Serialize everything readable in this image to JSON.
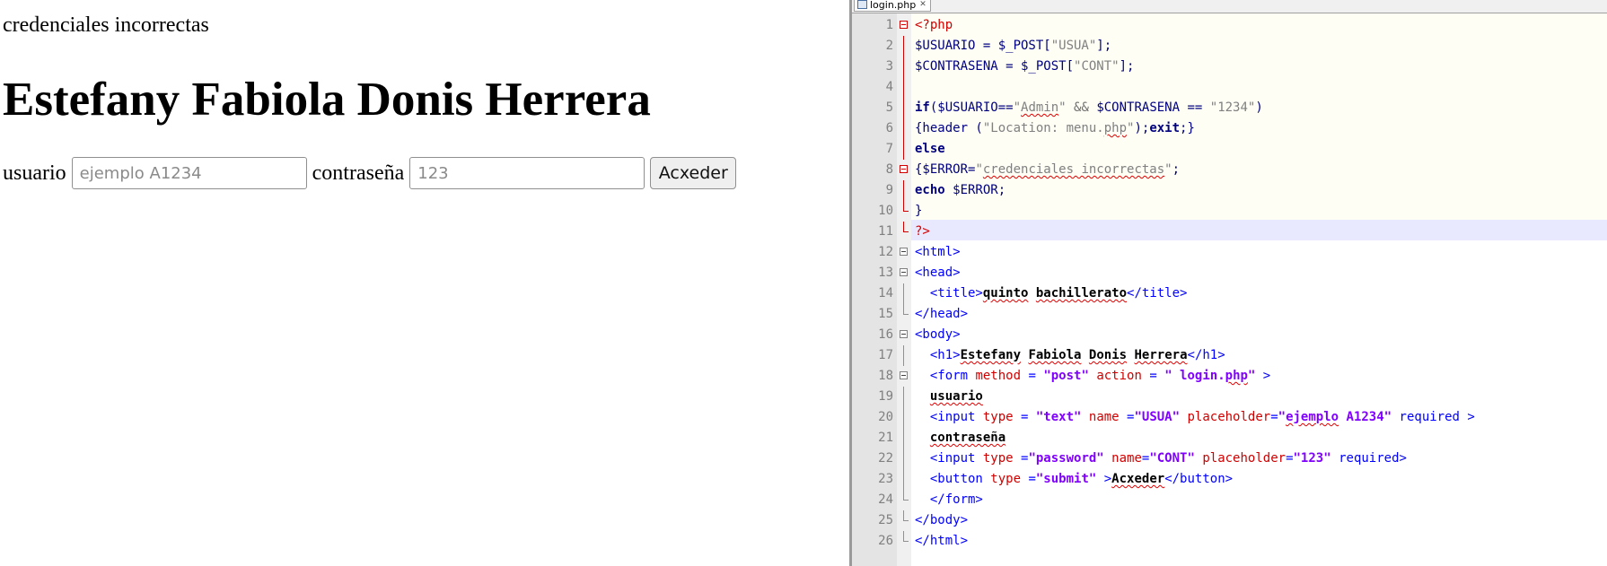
{
  "browser": {
    "error_message": "credenciales incorrectas",
    "heading": "Estefany Fabiola Donis Herrera",
    "usuario_label": "usuario",
    "usuario_placeholder": "ejemplo A1234",
    "password_label": "contraseña",
    "password_placeholder": "123",
    "submit_label": "Acxeder"
  },
  "editor": {
    "tab_label": "login.php",
    "tab_icon": "file-icon",
    "close_icon": "close-icon",
    "colors": {
      "php_tag": "#d00000",
      "variable": "#000080",
      "string": "#808080",
      "html_tag": "#0000ff",
      "attr_name": "#d00000",
      "attr_value": "#8000ff",
      "current_line": "#e8e8ff"
    },
    "lines": [
      [
        {
          "t": "<?php",
          "c": "php"
        }
      ],
      [
        {
          "t": "$USUARIO = $_POST[",
          "c": "var"
        },
        {
          "t": "\"USUA\"",
          "c": "str"
        },
        {
          "t": "];",
          "c": "var"
        }
      ],
      [
        {
          "t": "$CONTRASENA = $_POST[",
          "c": "var"
        },
        {
          "t": "\"CONT\"",
          "c": "str"
        },
        {
          "t": "];",
          "c": "var"
        }
      ],
      [],
      [
        {
          "t": "if",
          "c": "kw"
        },
        {
          "t": "($USUARIO==",
          "c": "var"
        },
        {
          "t": "\"",
          "c": "str"
        },
        {
          "t": "Admin",
          "c": "str",
          "s": true
        },
        {
          "t": "\"",
          "c": "str"
        },
        {
          "t": " && ",
          "c": "op"
        },
        {
          "t": "$CONTRASENA == ",
          "c": "var"
        },
        {
          "t": "\"1234\"",
          "c": "str"
        },
        {
          "t": ")",
          "c": "var"
        }
      ],
      [
        {
          "t": "{header (",
          "c": "var"
        },
        {
          "t": "\"Location: menu.",
          "c": "str"
        },
        {
          "t": "php",
          "c": "str",
          "s": true
        },
        {
          "t": "\"",
          "c": "str"
        },
        {
          "t": ");",
          "c": "var"
        },
        {
          "t": "exit",
          "c": "kw"
        },
        {
          "t": ";}",
          "c": "var"
        }
      ],
      [
        {
          "t": "else",
          "c": "kw"
        }
      ],
      [
        {
          "t": "{$ERROR=",
          "c": "var"
        },
        {
          "t": "\"",
          "c": "str"
        },
        {
          "t": "credenciales incorrectas",
          "c": "str",
          "s": true
        },
        {
          "t": "\"",
          "c": "str"
        },
        {
          "t": ";",
          "c": "var"
        }
      ],
      [
        {
          "t": "echo",
          "c": "kw"
        },
        {
          "t": " $ERROR;",
          "c": "var"
        }
      ],
      [
        {
          "t": "}",
          "c": "var"
        }
      ],
      [
        {
          "t": "?>",
          "c": "php"
        }
      ],
      [
        {
          "t": "<html>",
          "c": "tag"
        }
      ],
      [
        {
          "t": "<head>",
          "c": "tag"
        }
      ],
      [
        {
          "t": "  <title>",
          "c": "tag"
        },
        {
          "t": "quinto",
          "c": "bold",
          "s": true
        },
        {
          "t": " ",
          "c": "bold"
        },
        {
          "t": "bachillerato",
          "c": "bold",
          "s": true
        },
        {
          "t": "</title>",
          "c": "tag"
        }
      ],
      [
        {
          "t": "</head>",
          "c": "tag"
        }
      ],
      [
        {
          "t": "<body>",
          "c": "tag"
        }
      ],
      [
        {
          "t": "  <h1>",
          "c": "tag"
        },
        {
          "t": "Estefany",
          "c": "bold",
          "s": true
        },
        {
          "t": " ",
          "c": "bold"
        },
        {
          "t": "Fabiola",
          "c": "bold",
          "s": true
        },
        {
          "t": " ",
          "c": "bold"
        },
        {
          "t": "Donis",
          "c": "bold",
          "s": true
        },
        {
          "t": " ",
          "c": "bold"
        },
        {
          "t": "Herrera",
          "c": "bold",
          "s": true
        },
        {
          "t": "</h1>",
          "c": "tag"
        }
      ],
      [
        {
          "t": "  <form ",
          "c": "tag"
        },
        {
          "t": "method",
          "c": "attr"
        },
        {
          "t": " = ",
          "c": "tag"
        },
        {
          "t": "\"post\"",
          "c": "aval"
        },
        {
          "t": " ",
          "c": "tag"
        },
        {
          "t": "action",
          "c": "attr"
        },
        {
          "t": " = ",
          "c": "tag"
        },
        {
          "t": "\" login.",
          "c": "aval"
        },
        {
          "t": "php",
          "c": "aval",
          "s": true
        },
        {
          "t": "\"",
          "c": "aval"
        },
        {
          "t": " >",
          "c": "tag"
        }
      ],
      [
        {
          "t": "  ",
          "c": "plain"
        },
        {
          "t": "usuario",
          "c": "bold",
          "s": true
        }
      ],
      [
        {
          "t": "  <input ",
          "c": "tag"
        },
        {
          "t": "type",
          "c": "attr"
        },
        {
          "t": " = ",
          "c": "tag"
        },
        {
          "t": "\"text\"",
          "c": "aval"
        },
        {
          "t": " ",
          "c": "tag"
        },
        {
          "t": "name",
          "c": "attr"
        },
        {
          "t": " =",
          "c": "tag"
        },
        {
          "t": "\"USUA\"",
          "c": "aval"
        },
        {
          "t": " ",
          "c": "tag"
        },
        {
          "t": "placeholder",
          "c": "attr"
        },
        {
          "t": "=",
          "c": "tag"
        },
        {
          "t": "\"",
          "c": "aval"
        },
        {
          "t": "ejemplo",
          "c": "aval",
          "s": true
        },
        {
          "t": " A1234\"",
          "c": "aval"
        },
        {
          "t": " required >",
          "c": "tag"
        }
      ],
      [
        {
          "t": "  ",
          "c": "plain"
        },
        {
          "t": "contraseña",
          "c": "bold",
          "s": true
        }
      ],
      [
        {
          "t": "  <input ",
          "c": "tag"
        },
        {
          "t": "type",
          "c": "attr"
        },
        {
          "t": " =",
          "c": "tag"
        },
        {
          "t": "\"password\"",
          "c": "aval"
        },
        {
          "t": " ",
          "c": "tag"
        },
        {
          "t": "name",
          "c": "attr"
        },
        {
          "t": "=",
          "c": "tag"
        },
        {
          "t": "\"CONT\"",
          "c": "aval"
        },
        {
          "t": " ",
          "c": "tag"
        },
        {
          "t": "placeholder",
          "c": "attr"
        },
        {
          "t": "=",
          "c": "tag"
        },
        {
          "t": "\"123\"",
          "c": "aval"
        },
        {
          "t": " required>",
          "c": "tag"
        }
      ],
      [
        {
          "t": "  <button ",
          "c": "tag"
        },
        {
          "t": "type",
          "c": "attr"
        },
        {
          "t": " =",
          "c": "tag"
        },
        {
          "t": "\"submit\"",
          "c": "aval"
        },
        {
          "t": " >",
          "c": "tag"
        },
        {
          "t": "Acxeder",
          "c": "bold",
          "s": true
        },
        {
          "t": "</button>",
          "c": "tag"
        }
      ],
      [
        {
          "t": "  </form>",
          "c": "tag"
        }
      ],
      [
        {
          "t": "</body>",
          "c": "tag"
        }
      ],
      [
        {
          "t": "</html>",
          "c": "tag"
        }
      ]
    ]
  }
}
